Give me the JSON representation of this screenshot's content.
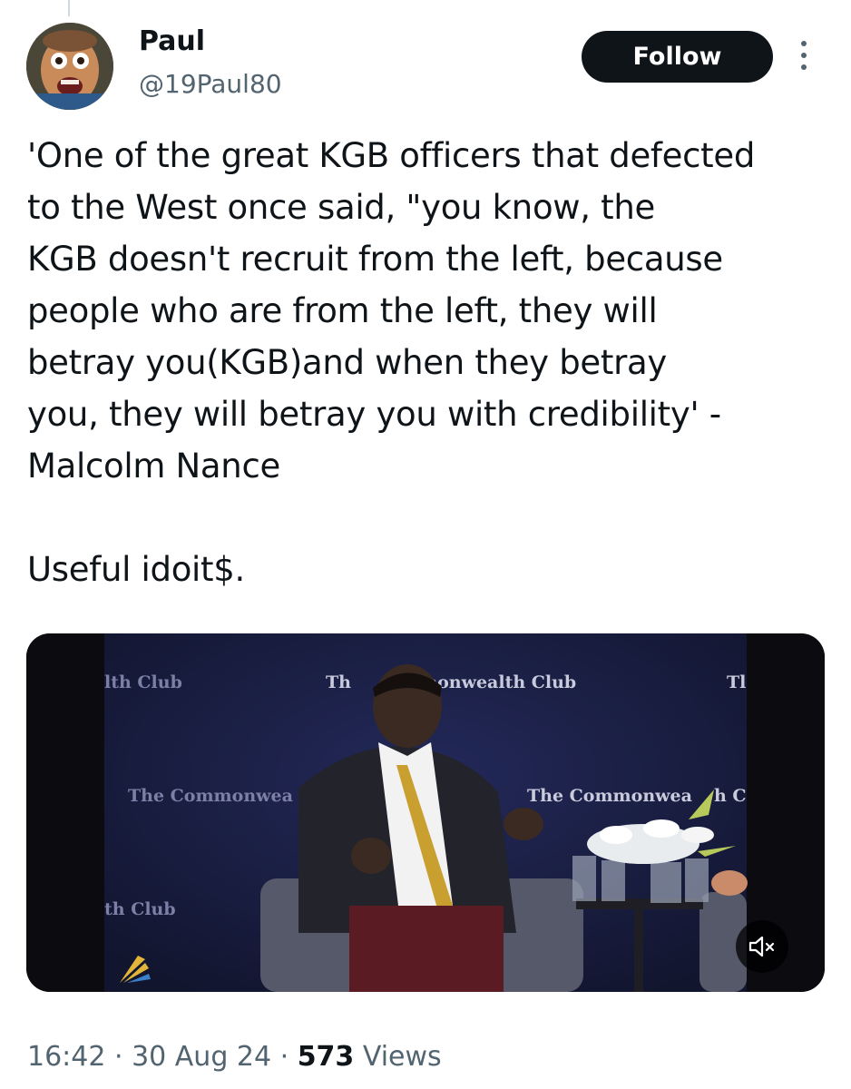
{
  "author": {
    "name": "Paul",
    "handle": "@19Paul80"
  },
  "actions": {
    "follow_label": "Follow"
  },
  "tweet": {
    "text": "'One of the great KGB officers that defected\nto the West once said, \"you know, the\nKGB doesn't recruit from the left, because\npeople who are from the left, they will\nbetray you(KGB)and when they betray\nyou, they will betray you with credibility' -\nMalcolm Nance\n\nUseful idoit$."
  },
  "video": {
    "backdrop_texts": [
      "lth Club",
      "Th",
      "monwealth Club",
      "Tl",
      "The Commonwea",
      "The Commonwea",
      "h C",
      "th Club"
    ],
    "muted": true
  },
  "meta": {
    "time": "16:42",
    "sep1": " · ",
    "date": "30 Aug 24",
    "sep2": " · ",
    "views_count": "573",
    "views_label": " Views"
  },
  "colors": {
    "text": "#0f1419",
    "secondary": "#536471",
    "button_bg": "#0f1419",
    "backdrop": "#1a2048"
  }
}
